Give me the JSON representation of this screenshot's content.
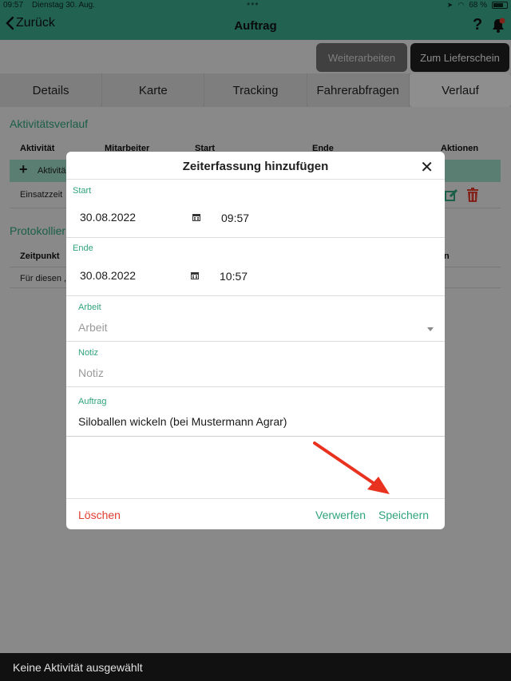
{
  "status": {
    "time": "09:57",
    "date": "Dienstag 30. Aug.",
    "battery": "68 %"
  },
  "header": {
    "back_label": "Zurück",
    "title": "Auftrag",
    "help": "?"
  },
  "actions": {
    "continue_label": "Weiterarbeiten",
    "delivery_label": "Zum Lieferschein"
  },
  "tabs": [
    {
      "label": "Details"
    },
    {
      "label": "Karte"
    },
    {
      "label": "Tracking"
    },
    {
      "label": "Fahrerabfragen"
    },
    {
      "label": "Verlauf",
      "active": true
    }
  ],
  "activity": {
    "title": "Aktivitätsverlauf",
    "headers": [
      "Aktivität",
      "Mitarbeiter",
      "Start",
      "Ende",
      "Aktionen"
    ],
    "add_row": "Aktivitä",
    "row1": "Einsatzzeit"
  },
  "protocol": {
    "title": "Protokollier",
    "header_time": "Zeitpunkt",
    "header_end": "n",
    "row1": "Für diesen ,"
  },
  "modal": {
    "title": "Zeiterfassung hinzufügen",
    "start": {
      "label": "Start",
      "date": "30.08.2022",
      "time": "09:57"
    },
    "end": {
      "label": "Ende",
      "date": "30.08.2022",
      "time": "10:57"
    },
    "work": {
      "label": "Arbeit",
      "placeholder": "Arbeit"
    },
    "note": {
      "label": "Notiz",
      "placeholder": "Notiz"
    },
    "order": {
      "label": "Auftrag",
      "value": "Siloballen wickeln (bei Mustermann Agrar)"
    },
    "delete_label": "Löschen",
    "discard_label": "Verwerfen",
    "save_label": "Speichern"
  },
  "bottom": {
    "status": "Keine Aktivität ausgewählt"
  },
  "colors": {
    "accent": "#3aa98c",
    "delete": "#e23b2e",
    "arrow": "#e8321f"
  }
}
